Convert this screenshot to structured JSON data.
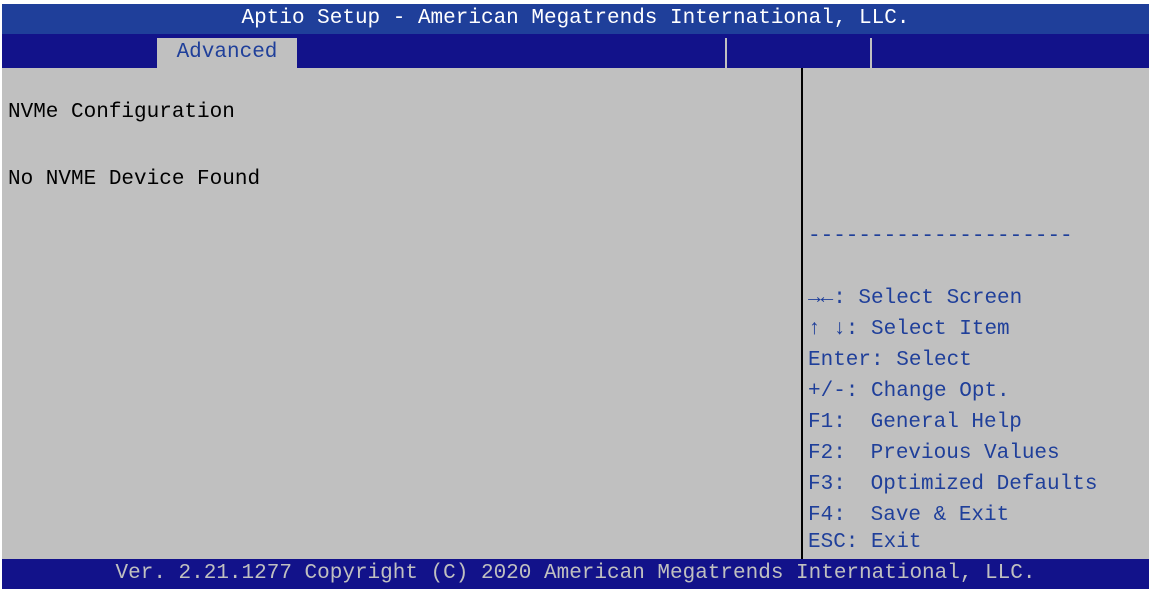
{
  "window": {
    "title": "Aptio Setup - American Megatrends International, LLC."
  },
  "tabs": [
    {
      "label": "Advanced",
      "active": true
    }
  ],
  "main": {
    "heading": "NVMe Configuration",
    "status": "No NVME Device Found"
  },
  "help": {
    "separator": "---------------------",
    "keys": [
      {
        "key": "→←:",
        "action": "Select Screen"
      },
      {
        "key": "↑ ↓:",
        "action": "Select Item"
      },
      {
        "key": "Enter:",
        "action": "Select"
      },
      {
        "key": "+/-:",
        "action": "Change Opt."
      },
      {
        "key": "F1:",
        "action": "General Help"
      },
      {
        "key": "F2:",
        "action": "Previous Values"
      },
      {
        "key": "F3:",
        "action": "Optimized Defaults"
      },
      {
        "key": "F4:",
        "action": "Save & Exit"
      },
      {
        "key": "ESC:",
        "action": "Exit"
      }
    ]
  },
  "footer": {
    "text": "Ver. 2.21.1277 Copyright (C) 2020 American Megatrends International, LLC."
  },
  "colors": {
    "title_bg": "#1f3f9a",
    "tab_bar_bg": "#12128a",
    "panel_bg": "#c0c0c0",
    "help_text": "#1f3f9a"
  }
}
